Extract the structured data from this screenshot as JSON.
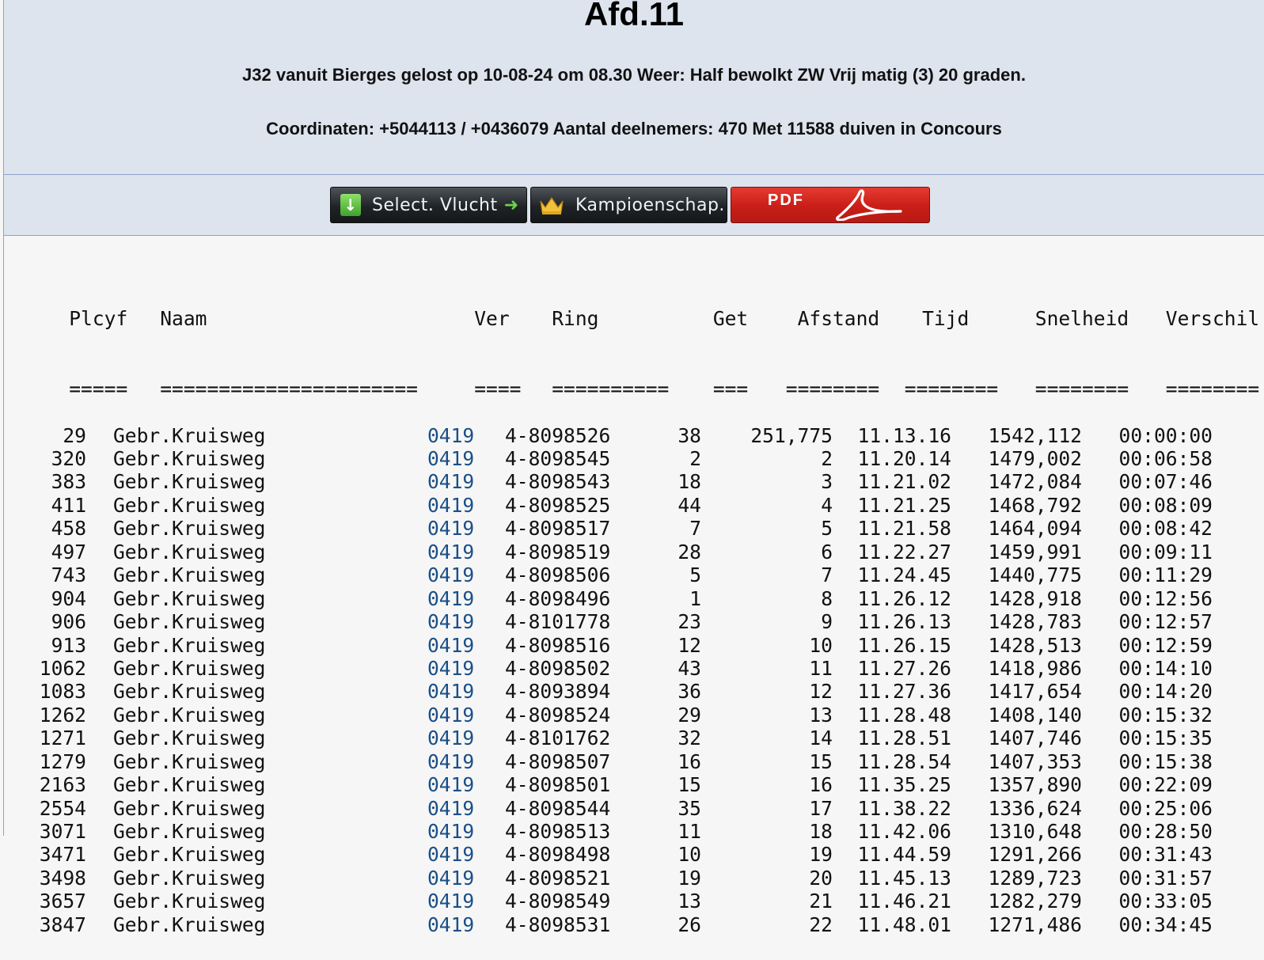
{
  "header": {
    "title": "Afd.11",
    "line1": "J32 vanuit Bierges gelost op 10-08-24 om 08.30 Weer: Half bewolkt ZW Vrij matig (3) 20 graden.",
    "line2": "Coordinaten: +5044113 / +0436079 Aantal deelnemers: 470 Met 11588 duiven in Concours"
  },
  "toolbar": {
    "select_label": "Select. Vlucht",
    "kampioenschap_label": "Kampioenschap.",
    "pdf_label": "PDF"
  },
  "table": {
    "columns": [
      "Plcyf",
      "Naam",
      "Ver",
      "Ring",
      "Get",
      "Afstand",
      "Tijd",
      "Snelheid",
      "Verschil"
    ],
    "underlines": [
      "=====",
      "======================",
      "====",
      "==========",
      "===",
      "========",
      "========",
      "========",
      "========"
    ],
    "rows": [
      {
        "plc": "29",
        "naam": "Gebr.Kruisweg",
        "ver": "0419",
        "ring": "4-8098526",
        "get": "38",
        "afstand": "251,775",
        "tijd": "11.13.16",
        "snelheid": "1542,112",
        "verschil": "00:00:00"
      },
      {
        "plc": "320",
        "naam": "Gebr.Kruisweg",
        "ver": "0419",
        "ring": "4-8098545",
        "get": "2",
        "afstand": "2",
        "tijd": "11.20.14",
        "snelheid": "1479,002",
        "verschil": "00:06:58"
      },
      {
        "plc": "383",
        "naam": "Gebr.Kruisweg",
        "ver": "0419",
        "ring": "4-8098543",
        "get": "18",
        "afstand": "3",
        "tijd": "11.21.02",
        "snelheid": "1472,084",
        "verschil": "00:07:46"
      },
      {
        "plc": "411",
        "naam": "Gebr.Kruisweg",
        "ver": "0419",
        "ring": "4-8098525",
        "get": "44",
        "afstand": "4",
        "tijd": "11.21.25",
        "snelheid": "1468,792",
        "verschil": "00:08:09"
      },
      {
        "plc": "458",
        "naam": "Gebr.Kruisweg",
        "ver": "0419",
        "ring": "4-8098517",
        "get": "7",
        "afstand": "5",
        "tijd": "11.21.58",
        "snelheid": "1464,094",
        "verschil": "00:08:42"
      },
      {
        "plc": "497",
        "naam": "Gebr.Kruisweg",
        "ver": "0419",
        "ring": "4-8098519",
        "get": "28",
        "afstand": "6",
        "tijd": "11.22.27",
        "snelheid": "1459,991",
        "verschil": "00:09:11"
      },
      {
        "plc": "743",
        "naam": "Gebr.Kruisweg",
        "ver": "0419",
        "ring": "4-8098506",
        "get": "5",
        "afstand": "7",
        "tijd": "11.24.45",
        "snelheid": "1440,775",
        "verschil": "00:11:29"
      },
      {
        "plc": "904",
        "naam": "Gebr.Kruisweg",
        "ver": "0419",
        "ring": "4-8098496",
        "get": "1",
        "afstand": "8",
        "tijd": "11.26.12",
        "snelheid": "1428,918",
        "verschil": "00:12:56"
      },
      {
        "plc": "906",
        "naam": "Gebr.Kruisweg",
        "ver": "0419",
        "ring": "4-8101778",
        "get": "23",
        "afstand": "9",
        "tijd": "11.26.13",
        "snelheid": "1428,783",
        "verschil": "00:12:57"
      },
      {
        "plc": "913",
        "naam": "Gebr.Kruisweg",
        "ver": "0419",
        "ring": "4-8098516",
        "get": "12",
        "afstand": "10",
        "tijd": "11.26.15",
        "snelheid": "1428,513",
        "verschil": "00:12:59"
      },
      {
        "plc": "1062",
        "naam": "Gebr.Kruisweg",
        "ver": "0419",
        "ring": "4-8098502",
        "get": "43",
        "afstand": "11",
        "tijd": "11.27.26",
        "snelheid": "1418,986",
        "verschil": "00:14:10"
      },
      {
        "plc": "1083",
        "naam": "Gebr.Kruisweg",
        "ver": "0419",
        "ring": "4-8093894",
        "get": "36",
        "afstand": "12",
        "tijd": "11.27.36",
        "snelheid": "1417,654",
        "verschil": "00:14:20"
      },
      {
        "plc": "1262",
        "naam": "Gebr.Kruisweg",
        "ver": "0419",
        "ring": "4-8098524",
        "get": "29",
        "afstand": "13",
        "tijd": "11.28.48",
        "snelheid": "1408,140",
        "verschil": "00:15:32"
      },
      {
        "plc": "1271",
        "naam": "Gebr.Kruisweg",
        "ver": "0419",
        "ring": "4-8101762",
        "get": "32",
        "afstand": "14",
        "tijd": "11.28.51",
        "snelheid": "1407,746",
        "verschil": "00:15:35"
      },
      {
        "plc": "1279",
        "naam": "Gebr.Kruisweg",
        "ver": "0419",
        "ring": "4-8098507",
        "get": "16",
        "afstand": "15",
        "tijd": "11.28.54",
        "snelheid": "1407,353",
        "verschil": "00:15:38"
      },
      {
        "plc": "2163",
        "naam": "Gebr.Kruisweg",
        "ver": "0419",
        "ring": "4-8098501",
        "get": "15",
        "afstand": "16",
        "tijd": "11.35.25",
        "snelheid": "1357,890",
        "verschil": "00:22:09"
      },
      {
        "plc": "2554",
        "naam": "Gebr.Kruisweg",
        "ver": "0419",
        "ring": "4-8098544",
        "get": "35",
        "afstand": "17",
        "tijd": "11.38.22",
        "snelheid": "1336,624",
        "verschil": "00:25:06"
      },
      {
        "plc": "3071",
        "naam": "Gebr.Kruisweg",
        "ver": "0419",
        "ring": "4-8098513",
        "get": "11",
        "afstand": "18",
        "tijd": "11.42.06",
        "snelheid": "1310,648",
        "verschil": "00:28:50"
      },
      {
        "plc": "3471",
        "naam": "Gebr.Kruisweg",
        "ver": "0419",
        "ring": "4-8098498",
        "get": "10",
        "afstand": "19",
        "tijd": "11.44.59",
        "snelheid": "1291,266",
        "verschil": "00:31:43"
      },
      {
        "plc": "3498",
        "naam": "Gebr.Kruisweg",
        "ver": "0419",
        "ring": "4-8098521",
        "get": "19",
        "afstand": "20",
        "tijd": "11.45.13",
        "snelheid": "1289,723",
        "verschil": "00:31:57"
      },
      {
        "plc": "3657",
        "naam": "Gebr.Kruisweg",
        "ver": "0419",
        "ring": "4-8098549",
        "get": "13",
        "afstand": "21",
        "tijd": "11.46.21",
        "snelheid": "1282,279",
        "verschil": "00:33:05"
      },
      {
        "plc": "3847",
        "naam": "Gebr.Kruisweg",
        "ver": "0419",
        "ring": "4-8098531",
        "get": "26",
        "afstand": "22",
        "tijd": "11.48.01",
        "snelheid": "1271,486",
        "verschil": "00:34:45"
      }
    ]
  }
}
